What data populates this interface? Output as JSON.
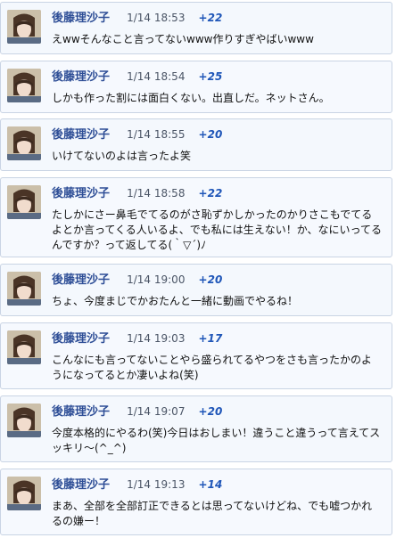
{
  "posts": [
    {
      "author": "後藤理沙子",
      "time": "1/14 18:53",
      "score": "+22",
      "text": "えwwそんなこと言ってないwww作りすぎやばいwww"
    },
    {
      "author": "後藤理沙子",
      "time": "1/14 18:54",
      "score": "+25",
      "text": "しかも作った割には面白くない。出直しだ。ネットさん。"
    },
    {
      "author": "後藤理沙子",
      "time": "1/14 18:55",
      "score": "+20",
      "text": "いけてないのよは言ったよ笑"
    },
    {
      "author": "後藤理沙子",
      "time": "1/14 18:58",
      "score": "+22",
      "text": "たしかにさー鼻毛でてるのがさ恥ずかしかったのかりさこもでてるよとか言ってくる人いるよ、でも私には生えない！か、なにいってるんですか？って返してる(｀▽´)ﾉ"
    },
    {
      "author": "後藤理沙子",
      "time": "1/14 19:00",
      "score": "+20",
      "text": "ちょ、今度まじでかおたんと一緒に動画でやるね！"
    },
    {
      "author": "後藤理沙子",
      "time": "1/14 19:03",
      "score": "+17",
      "text": "こんなにも言ってないことやら盛られてるやつをさも言ったかのようになってるとか凄いよね(笑)"
    },
    {
      "author": "後藤理沙子",
      "time": "1/14 19:07",
      "score": "+20",
      "text": "今度本格的にやるわ(笑)今日はおしまい！違うこと違うって言えてスッキリ〜(^_^)"
    },
    {
      "author": "後藤理沙子",
      "time": "1/14 19:13",
      "score": "+14",
      "text": "まあ、全部を全部訂正できるとは思ってないけどね、でも嘘つかれるの嫌ー！"
    }
  ]
}
